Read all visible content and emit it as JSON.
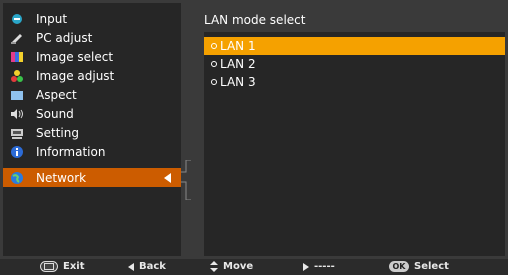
{
  "menu": {
    "items": [
      {
        "label": "Input",
        "icon": "input-icon"
      },
      {
        "label": "PC adjust",
        "icon": "pc-adjust-icon"
      },
      {
        "label": "Image select",
        "icon": "image-select-icon"
      },
      {
        "label": "Image adjust",
        "icon": "image-adjust-icon"
      },
      {
        "label": "Aspect",
        "icon": "aspect-icon"
      },
      {
        "label": "Sound",
        "icon": "sound-icon"
      },
      {
        "label": "Setting",
        "icon": "setting-icon"
      },
      {
        "label": "Information",
        "icon": "information-icon"
      },
      {
        "label": "Network",
        "icon": "network-icon"
      }
    ],
    "selected": "Network"
  },
  "panel": {
    "title": "LAN mode select",
    "options": [
      "LAN 1",
      "LAN 2",
      "LAN 3"
    ],
    "selected": "LAN 1"
  },
  "bottombar": {
    "exit": "Exit",
    "back": "Back",
    "move": "Move",
    "next": "-----",
    "ok_key": "OK",
    "select": "Select"
  },
  "colors": {
    "menu_highlight": "#cc5c00",
    "option_highlight": "#f5a100",
    "background": "#262626",
    "frame": "#3a3a3a"
  }
}
